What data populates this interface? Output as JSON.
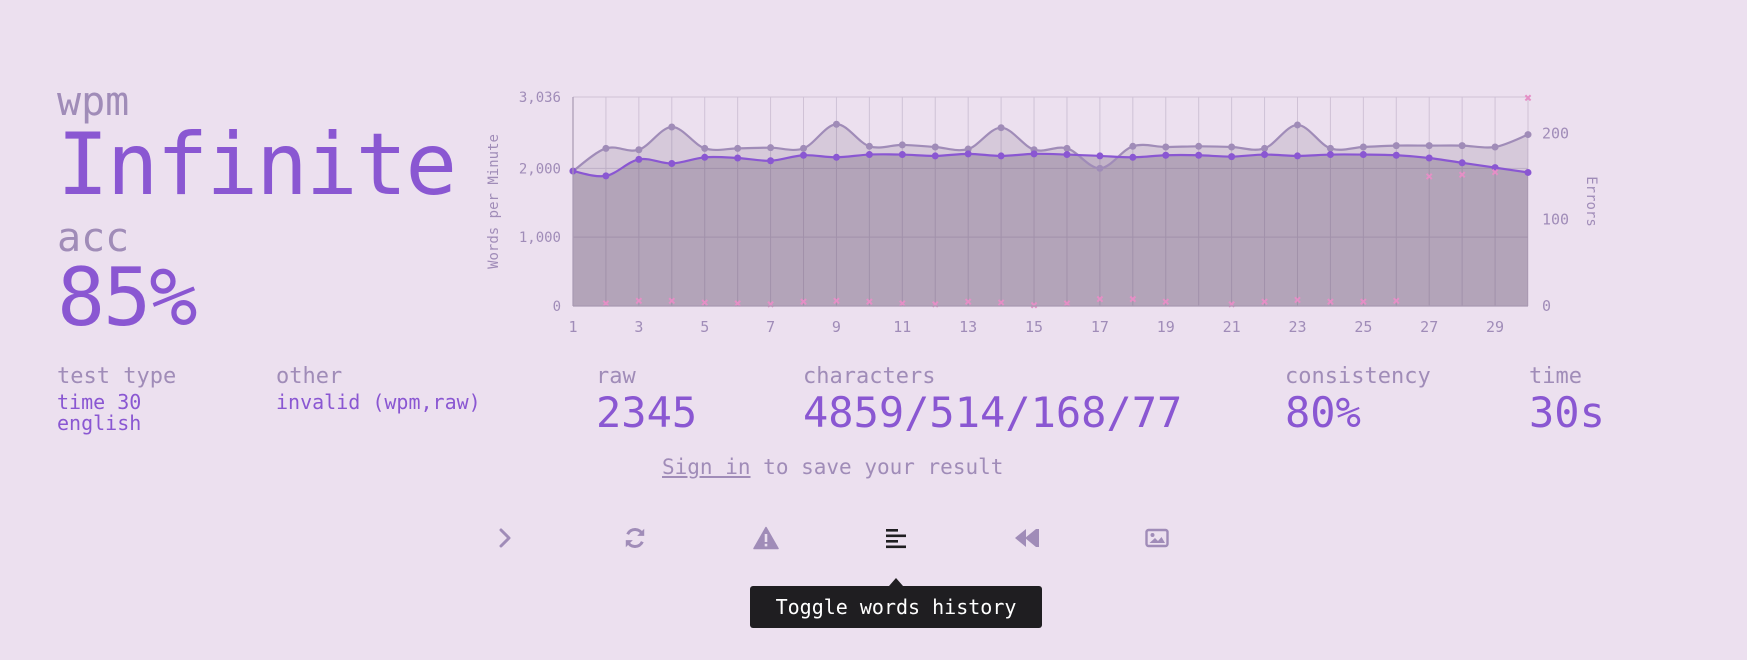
{
  "result": {
    "wpm_label": "wpm",
    "wpm_value": "Infinite",
    "acc_label": "acc",
    "acc_value": "85%"
  },
  "stats": {
    "test_type_label": "test type",
    "test_type_line1": "time 30",
    "test_type_line2": "english",
    "other_label": "other",
    "other_value": "invalid (wpm,raw)",
    "raw_label": "raw",
    "raw_value": "2345",
    "characters_label": "characters",
    "characters_value": "4859/514/168/77",
    "consistency_label": "consistency",
    "consistency_value": "80%",
    "time_label": "time",
    "time_value": "30s"
  },
  "signin": {
    "link": "Sign in",
    "rest": "to save your result"
  },
  "buttons": [
    {
      "name": "next-test-button",
      "icon": "chevron-right-icon"
    },
    {
      "name": "restart-test-button",
      "icon": "refresh-icon"
    },
    {
      "name": "report-button",
      "icon": "warning-icon"
    },
    {
      "name": "toggle-words-history-button",
      "icon": "align-left-icon"
    },
    {
      "name": "watch-replay-button",
      "icon": "backward-icon"
    },
    {
      "name": "save-screenshot-button",
      "icon": "image-icon"
    }
  ],
  "tooltip": {
    "text": "Toggle words history"
  },
  "colors": {
    "background": "#ece0ef",
    "main": "#8a57d2",
    "sub": "#a08cb8",
    "error": "#e58fc6"
  },
  "chart_data": {
    "type": "line",
    "x": [
      1,
      2,
      3,
      4,
      5,
      6,
      7,
      8,
      9,
      10,
      11,
      12,
      13,
      14,
      15,
      16,
      17,
      18,
      19,
      20,
      21,
      22,
      23,
      24,
      25,
      26,
      27,
      28,
      29,
      30
    ],
    "x_ticks": [
      "1",
      "3",
      "5",
      "7",
      "9",
      "11",
      "13",
      "15",
      "17",
      "19",
      "21",
      "23",
      "25",
      "27",
      "29"
    ],
    "y_left_ticks": [
      "0",
      "1,000",
      "2,000",
      "3,036"
    ],
    "y_right_ticks": [
      "0",
      "100",
      "200"
    ],
    "ylabel": "Words per Minute",
    "ylabel_right": "Errors",
    "ylim": [
      0,
      3036
    ],
    "ylim_right": [
      0,
      242
    ],
    "grid": true,
    "series": [
      {
        "role": "raw",
        "axis": "left",
        "values": [
          1960,
          2290,
          2270,
          2600,
          2290,
          2290,
          2300,
          2290,
          2640,
          2320,
          2340,
          2310,
          2280,
          2590,
          2270,
          2290,
          2000,
          2320,
          2310,
          2320,
          2310,
          2290,
          2630,
          2290,
          2310,
          2330,
          2330,
          2330,
          2310,
          2490
        ]
      },
      {
        "role": "wpm",
        "axis": "left",
        "values": [
          1960,
          1890,
          2130,
          2070,
          2160,
          2150,
          2110,
          2190,
          2160,
          2200,
          2200,
          2180,
          2210,
          2180,
          2210,
          2200,
          2180,
          2160,
          2190,
          2190,
          2170,
          2200,
          2180,
          2200,
          2200,
          2190,
          2150,
          2080,
          2010,
          1940
        ]
      },
      {
        "role": "errors",
        "axis": "right",
        "values": [
          0,
          3,
          6,
          6,
          4,
          3,
          2,
          5,
          6,
          5,
          3,
          2,
          5,
          4,
          1,
          3,
          8,
          8,
          5,
          0,
          2,
          5,
          7,
          5,
          5,
          6,
          150,
          152,
          155,
          241
        ]
      }
    ]
  }
}
